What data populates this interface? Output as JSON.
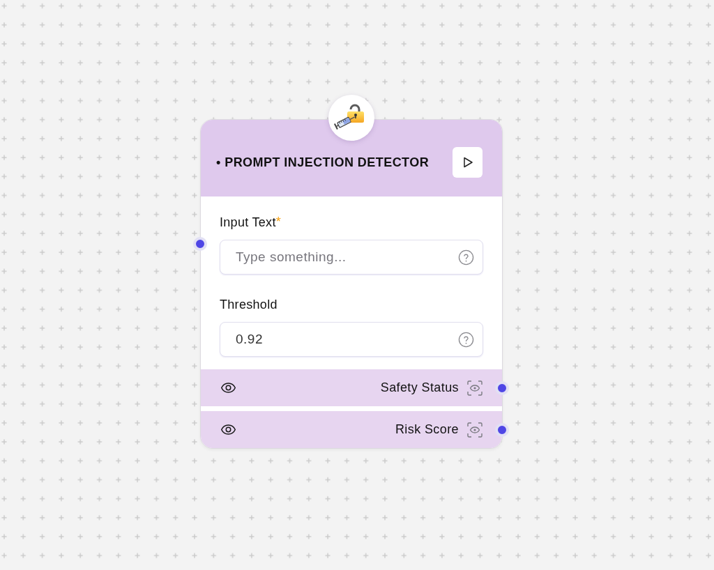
{
  "node": {
    "title": "• PROMPT INJECTION DETECTOR",
    "fields": [
      {
        "label": "Input Text",
        "required_mark": "*",
        "placeholder": "Type something...",
        "handle": true
      },
      {
        "label": "Threshold",
        "value": "0.92",
        "handle": false
      }
    ],
    "outputs": [
      {
        "label": "Safety Status",
        "handle": true
      },
      {
        "label": "Risk Score",
        "handle": true
      }
    ]
  }
}
